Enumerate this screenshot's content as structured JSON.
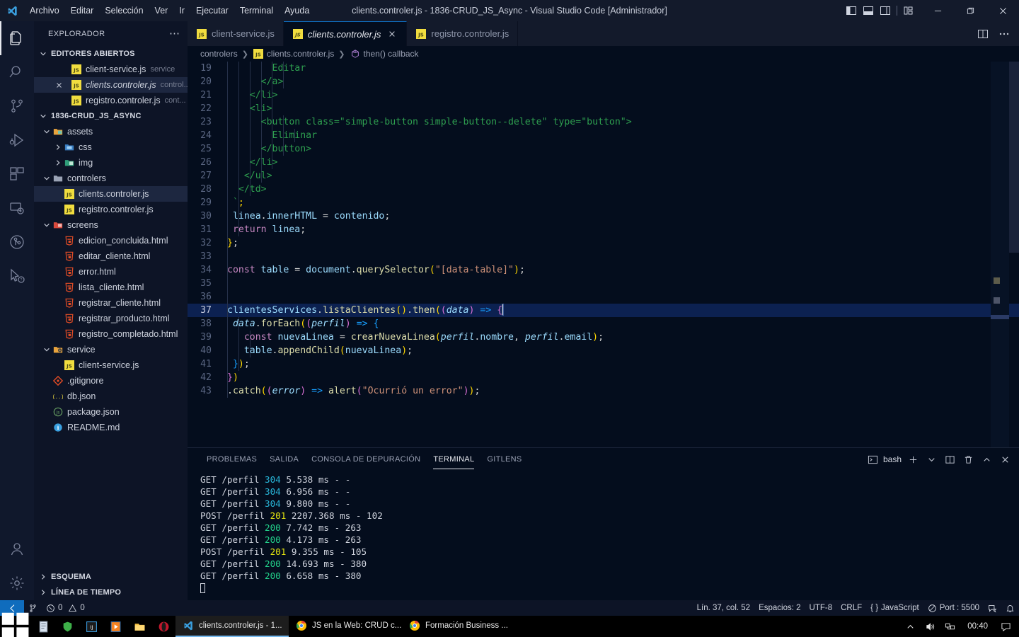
{
  "window": {
    "title": "clients.controler.js - 1836-CRUD_JS_Async - Visual Studio Code [Administrador]",
    "menu": [
      "Archivo",
      "Editar",
      "Selección",
      "Ver",
      "Ir",
      "Ejecutar",
      "Terminal",
      "Ayuda"
    ]
  },
  "activitybar": {
    "items": [
      {
        "name": "explorer",
        "icon": "files-icon"
      },
      {
        "name": "search",
        "icon": "search-icon"
      },
      {
        "name": "source-control",
        "icon": "source-control-icon"
      },
      {
        "name": "run-debug",
        "icon": "run-debug-icon"
      },
      {
        "name": "extensions",
        "icon": "extensions-icon"
      },
      {
        "name": "remote-explorer",
        "icon": "remote-explorer-icon"
      },
      {
        "name": "gitlens",
        "icon": "gitlens-icon"
      },
      {
        "name": "live-share",
        "icon": "live-share-icon"
      }
    ],
    "bottom": [
      {
        "name": "accounts",
        "icon": "account-icon"
      },
      {
        "name": "settings",
        "icon": "gear-icon"
      }
    ]
  },
  "sidebar": {
    "title": "EXPLORADOR",
    "open_editors": {
      "label": "EDITORES ABIERTOS",
      "items": [
        {
          "name": "client-service.js",
          "desc": "service",
          "icon": "js-icon",
          "selected": false,
          "dirty": false
        },
        {
          "name": "clients.controler.js",
          "desc": "control...",
          "icon": "js-icon",
          "selected": true,
          "dirty": false
        },
        {
          "name": "registro.controler.js",
          "desc": "cont...",
          "icon": "js-icon",
          "selected": false,
          "dirty": false
        }
      ]
    },
    "project": {
      "label": "1836-CRUD_JS_ASYNC",
      "tree": [
        {
          "name": "assets",
          "type": "folder",
          "depth": 1,
          "expanded": true,
          "icon": "folder-assets-icon"
        },
        {
          "name": "css",
          "type": "folder",
          "depth": 2,
          "expanded": false,
          "icon": "folder-css-icon"
        },
        {
          "name": "img",
          "type": "folder",
          "depth": 2,
          "expanded": false,
          "icon": "folder-img-icon"
        },
        {
          "name": "controlers",
          "type": "folder",
          "depth": 1,
          "expanded": true,
          "icon": "folder-icon"
        },
        {
          "name": "clients.controler.js",
          "type": "file",
          "depth": 2,
          "icon": "js-icon",
          "selected": true
        },
        {
          "name": "registro.controler.js",
          "type": "file",
          "depth": 2,
          "icon": "js-icon"
        },
        {
          "name": "screens",
          "type": "folder",
          "depth": 1,
          "expanded": true,
          "icon": "folder-screens-icon"
        },
        {
          "name": "edicion_concluida.html",
          "type": "file",
          "depth": 2,
          "icon": "html-icon"
        },
        {
          "name": "editar_cliente.html",
          "type": "file",
          "depth": 2,
          "icon": "html-icon"
        },
        {
          "name": "error.html",
          "type": "file",
          "depth": 2,
          "icon": "html-icon"
        },
        {
          "name": "lista_cliente.html",
          "type": "file",
          "depth": 2,
          "icon": "html-icon"
        },
        {
          "name": "registrar_cliente.html",
          "type": "file",
          "depth": 2,
          "icon": "html-icon"
        },
        {
          "name": "registrar_producto.html",
          "type": "file",
          "depth": 2,
          "icon": "html-icon"
        },
        {
          "name": "registro_completado.html",
          "type": "file",
          "depth": 2,
          "icon": "html-icon"
        },
        {
          "name": "service",
          "type": "folder",
          "depth": 1,
          "expanded": true,
          "icon": "folder-service-icon"
        },
        {
          "name": "client-service.js",
          "type": "file",
          "depth": 2,
          "icon": "js-icon"
        },
        {
          "name": ".gitignore",
          "type": "file",
          "depth": 1,
          "icon": "git-icon"
        },
        {
          "name": "db.json",
          "type": "file",
          "depth": 1,
          "icon": "json-icon"
        },
        {
          "name": "package.json",
          "type": "file",
          "depth": 1,
          "icon": "npm-icon"
        },
        {
          "name": "README.md",
          "type": "file",
          "depth": 1,
          "icon": "info-icon"
        }
      ]
    },
    "collapsed_sections": [
      "ESQUEMA",
      "LÍNEA DE TIEMPO"
    ]
  },
  "tabs": [
    {
      "label": "client-service.js",
      "icon": "js-icon",
      "active": false
    },
    {
      "label": "clients.controler.js",
      "icon": "js-icon",
      "active": true,
      "closable": true
    },
    {
      "label": "registro.controler.js",
      "icon": "js-icon",
      "active": false
    }
  ],
  "breadcrumb": [
    {
      "label": "controlers",
      "icon": ""
    },
    {
      "label": "clients.controler.js",
      "icon": "js-icon"
    },
    {
      "label": "then() callback",
      "icon": "symbol-event-icon"
    }
  ],
  "editor": {
    "first_line": 19,
    "active_line": 37,
    "lines": [
      {
        "n": 19,
        "indent": 6,
        "tokens": [
          {
            "t": "        Editar",
            "c": "t-str"
          }
        ]
      },
      {
        "n": 20,
        "indent": 6,
        "tokens": [
          {
            "t": "      </a>",
            "c": "t-str"
          }
        ]
      },
      {
        "n": 21,
        "indent": 5,
        "tokens": [
          {
            "t": "    </li>",
            "c": "t-str"
          }
        ]
      },
      {
        "n": 22,
        "indent": 5,
        "tokens": [
          {
            "t": "    <li>",
            "c": "t-str"
          }
        ]
      },
      {
        "n": 23,
        "indent": 6,
        "tokens": [
          {
            "t": "      <button class=\"simple-button simple-button--delete\" type=\"button\">",
            "c": "t-str"
          }
        ]
      },
      {
        "n": 24,
        "indent": 7,
        "tokens": [
          {
            "t": "        Eliminar",
            "c": "t-str"
          }
        ]
      },
      {
        "n": 25,
        "indent": 6,
        "tokens": [
          {
            "t": "      </button>",
            "c": "t-str"
          }
        ]
      },
      {
        "n": 26,
        "indent": 5,
        "tokens": [
          {
            "t": "    </li>",
            "c": "t-str"
          }
        ]
      },
      {
        "n": 27,
        "indent": 4,
        "tokens": [
          {
            "t": "   </ul>",
            "c": "t-str"
          }
        ]
      },
      {
        "n": 28,
        "indent": 3,
        "tokens": [
          {
            "t": "  </td>",
            "c": "t-str"
          }
        ]
      },
      {
        "n": 29,
        "indent": 2,
        "tokens": [
          {
            "t": " `",
            "c": "t-str"
          },
          {
            "t": ";",
            "c": "t-y"
          }
        ]
      },
      {
        "n": 30,
        "indent": 2,
        "tokens": [
          {
            "t": " linea",
            "c": "t-var"
          },
          {
            "t": ".",
            "c": "t-op"
          },
          {
            "t": "innerHTML",
            "c": "t-prop"
          },
          {
            "t": " = ",
            "c": "t-op"
          },
          {
            "t": "contenido",
            "c": "t-var"
          },
          {
            "t": ";",
            "c": "t-op"
          }
        ]
      },
      {
        "n": 31,
        "indent": 2,
        "tokens": [
          {
            "t": " ",
            "c": "t-op"
          },
          {
            "t": "return",
            "c": "t-kw"
          },
          {
            "t": " ",
            "c": "t-op"
          },
          {
            "t": "linea",
            "c": "t-var"
          },
          {
            "t": ";",
            "c": "t-op"
          }
        ]
      },
      {
        "n": 32,
        "indent": 1,
        "tokens": [
          {
            "t": "}",
            "c": "t-y"
          },
          {
            "t": ";",
            "c": "t-op"
          }
        ]
      },
      {
        "n": 33,
        "indent": 1,
        "tokens": []
      },
      {
        "n": 34,
        "indent": 1,
        "tokens": [
          {
            "t": "const",
            "c": "t-kw"
          },
          {
            "t": " table ",
            "c": "t-var"
          },
          {
            "t": "= ",
            "c": "t-op"
          },
          {
            "t": "document",
            "c": "t-var"
          },
          {
            "t": ".",
            "c": "t-op"
          },
          {
            "t": "querySelector",
            "c": "t-fn"
          },
          {
            "t": "(",
            "c": "t-y"
          },
          {
            "t": "\"[data-table]\"",
            "c": "t-strq"
          },
          {
            "t": ")",
            "c": "t-y"
          },
          {
            "t": ";",
            "c": "t-op"
          }
        ]
      },
      {
        "n": 35,
        "indent": 1,
        "tokens": []
      },
      {
        "n": 36,
        "indent": 1,
        "tokens": []
      },
      {
        "n": 37,
        "indent": 1,
        "active": true,
        "tokens": [
          {
            "t": "clientesServices",
            "c": "t-var"
          },
          {
            "t": ".",
            "c": "t-op"
          },
          {
            "t": "listaClientes",
            "c": "t-fn"
          },
          {
            "t": "()",
            "c": "t-y"
          },
          {
            "t": ".",
            "c": "t-op"
          },
          {
            "t": "then",
            "c": "t-fn"
          },
          {
            "t": "(",
            "c": "t-y"
          },
          {
            "t": "(",
            "c": "t-p"
          },
          {
            "t": "data",
            "c": "t-par"
          },
          {
            "t": ")",
            "c": "t-p"
          },
          {
            "t": " => ",
            "c": "t-b"
          },
          {
            "t": "{",
            "c": "t-p"
          }
        ]
      },
      {
        "n": 38,
        "indent": 2,
        "tokens": [
          {
            "t": " ",
            "c": "t-op"
          },
          {
            "t": "data",
            "c": "t-par"
          },
          {
            "t": ".",
            "c": "t-op"
          },
          {
            "t": "forEach",
            "c": "t-fn"
          },
          {
            "t": "(",
            "c": "t-y"
          },
          {
            "t": "(",
            "c": "t-p"
          },
          {
            "t": "perfil",
            "c": "t-par"
          },
          {
            "t": ")",
            "c": "t-p"
          },
          {
            "t": " => ",
            "c": "t-b"
          },
          {
            "t": "{",
            "c": "t-b"
          }
        ]
      },
      {
        "n": 39,
        "indent": 3,
        "tokens": [
          {
            "t": "   ",
            "c": "t-op"
          },
          {
            "t": "const",
            "c": "t-kw"
          },
          {
            "t": " nuevaLinea ",
            "c": "t-var"
          },
          {
            "t": "= ",
            "c": "t-op"
          },
          {
            "t": "crearNuevaLinea",
            "c": "t-fn"
          },
          {
            "t": "(",
            "c": "t-y"
          },
          {
            "t": "perfil",
            "c": "t-par"
          },
          {
            "t": ".",
            "c": "t-op"
          },
          {
            "t": "nombre",
            "c": "t-prop"
          },
          {
            "t": ", ",
            "c": "t-op"
          },
          {
            "t": "perfil",
            "c": "t-par"
          },
          {
            "t": ".",
            "c": "t-op"
          },
          {
            "t": "email",
            "c": "t-prop"
          },
          {
            "t": ")",
            "c": "t-y"
          },
          {
            "t": ";",
            "c": "t-op"
          }
        ]
      },
      {
        "n": 40,
        "indent": 3,
        "tokens": [
          {
            "t": "   ",
            "c": "t-op"
          },
          {
            "t": "table",
            "c": "t-var"
          },
          {
            "t": ".",
            "c": "t-op"
          },
          {
            "t": "appendChild",
            "c": "t-fn"
          },
          {
            "t": "(",
            "c": "t-y"
          },
          {
            "t": "nuevaLinea",
            "c": "t-var"
          },
          {
            "t": ")",
            "c": "t-y"
          },
          {
            "t": ";",
            "c": "t-op"
          }
        ]
      },
      {
        "n": 41,
        "indent": 2,
        "tokens": [
          {
            "t": " ",
            "c": "t-op"
          },
          {
            "t": "}",
            "c": "t-b"
          },
          {
            "t": ")",
            "c": "t-y"
          },
          {
            "t": ";",
            "c": "t-op"
          }
        ]
      },
      {
        "n": 42,
        "indent": 1,
        "tokens": [
          {
            "t": "}",
            "c": "t-p"
          },
          {
            "t": ")",
            "c": "t-y"
          }
        ]
      },
      {
        "n": 43,
        "indent": 1,
        "tokens": [
          {
            "t": ".",
            "c": "t-op"
          },
          {
            "t": "catch",
            "c": "t-fn"
          },
          {
            "t": "(",
            "c": "t-y"
          },
          {
            "t": "(",
            "c": "t-p"
          },
          {
            "t": "error",
            "c": "t-par"
          },
          {
            "t": ")",
            "c": "t-p"
          },
          {
            "t": " => ",
            "c": "t-b"
          },
          {
            "t": "alert",
            "c": "t-fn"
          },
          {
            "t": "(",
            "c": "t-p"
          },
          {
            "t": "\"Ocurrió un error\"",
            "c": "t-strq"
          },
          {
            "t": ")",
            "c": "t-p"
          },
          {
            "t": ")",
            "c": "t-y"
          },
          {
            "t": ";",
            "c": "t-op"
          }
        ]
      }
    ]
  },
  "panel": {
    "tabs": [
      "PROBLEMAS",
      "SALIDA",
      "CONSOLA DE DEPURACIÓN",
      "TERMINAL",
      "GITLENS"
    ],
    "active_tab": "TERMINAL",
    "shell_label": "bash",
    "actions": [
      "new-terminal",
      "terminal-dropdown",
      "split-terminal",
      "kill-terminal",
      "maximize-panel",
      "close-panel"
    ],
    "terminal_lines": [
      {
        "method": "GET",
        "path": "/perfil",
        "status": "304",
        "status_color": "cyan",
        "time": "5.538 ms",
        "size": "- -"
      },
      {
        "method": "GET",
        "path": "/perfil",
        "status": "304",
        "status_color": "cyan",
        "time": "6.956 ms",
        "size": "- -"
      },
      {
        "method": "GET",
        "path": "/perfil",
        "status": "304",
        "status_color": "cyan",
        "time": "9.800 ms",
        "size": "- -"
      },
      {
        "method": "POST",
        "path": "/perfil",
        "status": "201",
        "status_color": "yellow",
        "time": "2207.368 ms",
        "size": "- 102"
      },
      {
        "method": "GET",
        "path": "/perfil",
        "status": "200",
        "status_color": "green",
        "time": "7.742 ms",
        "size": "- 263"
      },
      {
        "method": "GET",
        "path": "/perfil",
        "status": "200",
        "status_color": "green",
        "time": "4.173 ms",
        "size": "- 263"
      },
      {
        "method": "POST",
        "path": "/perfil",
        "status": "201",
        "status_color": "yellow",
        "time": "9.355 ms",
        "size": "- 105"
      },
      {
        "method": "GET",
        "path": "/perfil",
        "status": "200",
        "status_color": "green",
        "time": "14.693 ms",
        "size": "- 380"
      },
      {
        "method": "GET",
        "path": "/perfil",
        "status": "200",
        "status_color": "green",
        "time": "6.658 ms",
        "size": "- 380"
      }
    ]
  },
  "statusbar": {
    "remote_icon": "remote-indicator-icon",
    "branch_icon": "source-control-icon",
    "errors": "0",
    "warnings": "0",
    "cursor": "Lín. 37, col. 52",
    "indent": "Espacios: 2",
    "encoding": "UTF-8",
    "eol": "CRLF",
    "language": "JavaScript",
    "live_server": "Port : 5500",
    "feedback_icon": "feedback-icon",
    "bell_icon": "bell-icon"
  },
  "taskbar": {
    "start_icon": "windows-start-icon",
    "pinned": [
      "notepad-icon",
      "shield-icon",
      "ij-icon",
      "media-player-icon",
      "file-explorer-icon",
      "opera-icon"
    ],
    "apps": [
      {
        "label": "clients.controler.js - 1...",
        "icon": "vscode-icon",
        "active": true
      },
      {
        "label": "JS en la Web: CRUD c...",
        "icon": "chrome-icon",
        "active": false
      },
      {
        "label": "Formación Business ...",
        "icon": "chrome-icon",
        "active": false
      }
    ],
    "tray": [
      "chevron-up-icon",
      "volume-icon",
      "network-icon"
    ],
    "clock": "00:40",
    "action_center_icon": "action-center-icon"
  },
  "colors": {
    "accent": "#0f6cbd",
    "titlebar_bg": "#131a2b",
    "sidebar_bg": "#0d1426",
    "editor_bg": "#040d1d",
    "status_200": "#23d18b",
    "status_201": "#e5e510",
    "status_304": "#29b8db"
  }
}
